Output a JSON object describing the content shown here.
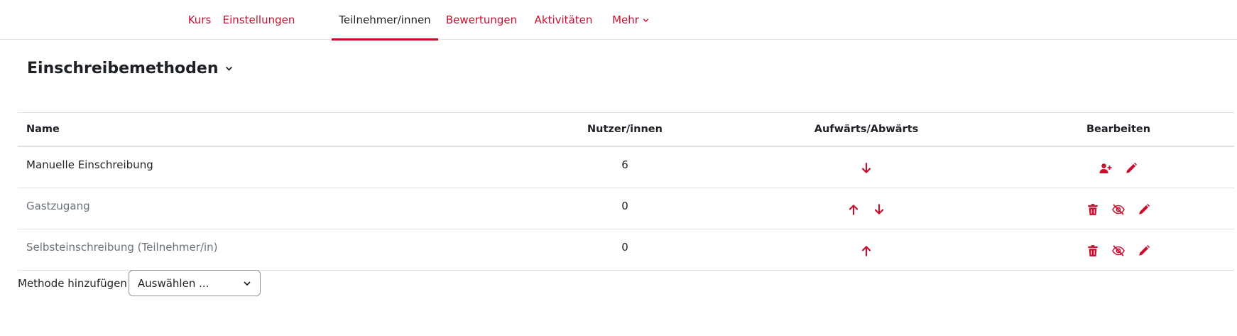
{
  "nav": {
    "tabs": [
      {
        "label": "Kurs"
      },
      {
        "label": "Einstellungen"
      },
      {
        "label": "Teilnehmer/innen"
      },
      {
        "label": "Bewertungen"
      },
      {
        "label": "Aktivitäten"
      },
      {
        "label": "Mehr"
      }
    ],
    "active_tab": "Teilnehmer/innen"
  },
  "page": {
    "title": "Einschreibemethoden"
  },
  "table": {
    "headers": {
      "name": "Name",
      "users": "Nutzer/innen",
      "move": "Aufwärts/Abwärts",
      "edit": "Bearbeiten"
    },
    "rows": [
      {
        "name": "Manuelle Einschreibung",
        "users": "6",
        "actions": [
          "enrol-users",
          "edit"
        ],
        "move": [
          "down"
        ]
      },
      {
        "name": "Gastzugang",
        "users": "0",
        "actions": [
          "delete",
          "disable",
          "edit"
        ],
        "move": [
          "up",
          "down"
        ]
      },
      {
        "name": "Selbsteinschreibung (Teilnehmer/in)",
        "users": "0",
        "actions": [
          "delete",
          "disable",
          "edit"
        ],
        "move": [
          "up"
        ]
      }
    ]
  },
  "add_method": {
    "label": "Methode hinzufügen",
    "select_value": "Auswählen ..."
  },
  "colors": {
    "accent": "#c8102e",
    "text": "#1d2125",
    "muted": "#6a737b",
    "border": "#dee2e6"
  }
}
